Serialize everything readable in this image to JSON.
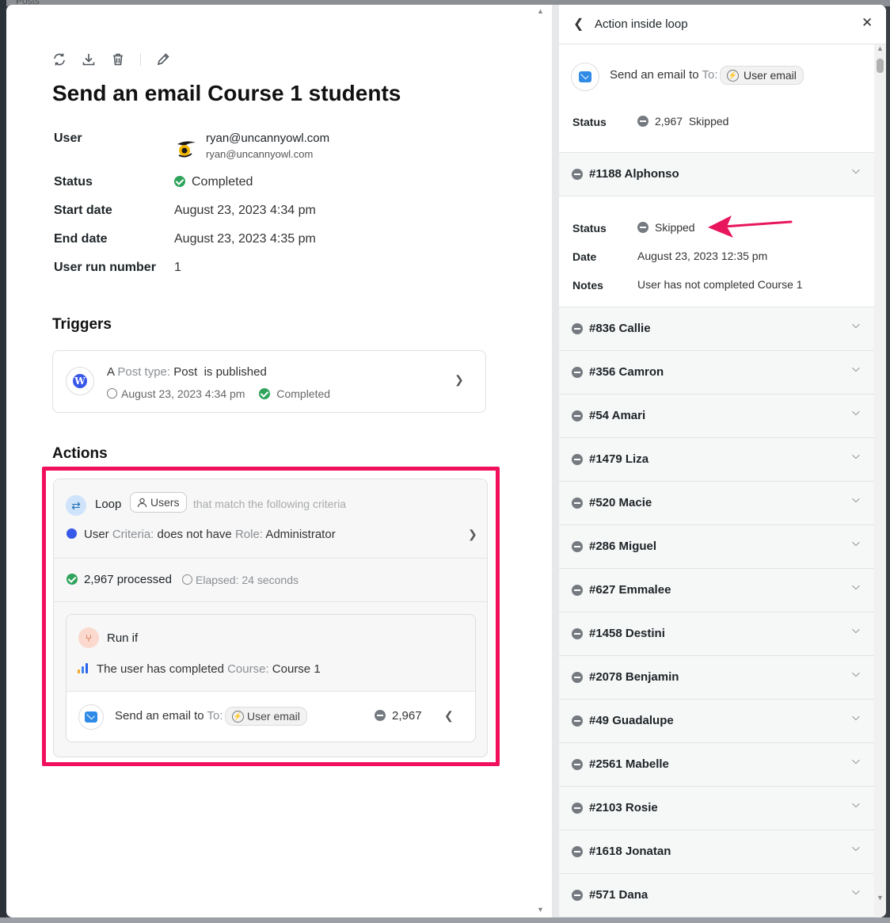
{
  "background": {
    "top_hint": "Posts"
  },
  "toolbar": {
    "icons": [
      "refresh-icon",
      "download-icon",
      "trash-icon",
      "edit-icon"
    ]
  },
  "page": {
    "title": "Send an email Course 1 students"
  },
  "meta": {
    "user_label": "User",
    "user_name": "ryan@uncannyowl.com",
    "user_email": "ryan@uncannyowl.com",
    "status_label": "Status",
    "status_value": "Completed",
    "start_label": "Start date",
    "start_value": "August 23, 2023 4:34 pm",
    "end_label": "End date",
    "end_value": "August 23, 2023 4:35 pm",
    "run_label": "User run number",
    "run_value": "1"
  },
  "triggers": {
    "heading": "Triggers",
    "a": "A",
    "post_type_label": "Post type:",
    "post_type_value": "Post",
    "published": "is published",
    "date": "August 23, 2023 4:34 pm",
    "status": "Completed"
  },
  "actions": {
    "heading": "Actions",
    "loop_label": "Loop",
    "loop_pill": "Users",
    "loop_criteria": "that match the following criteria",
    "crit_label": "User",
    "crit_key": "Criteria:",
    "crit_text": "does not have",
    "role_label": "Role:",
    "role_value": "Administrator",
    "processed": "2,967 processed",
    "elapsed": "Elapsed: 24 seconds",
    "runif_label": "Run if",
    "cond_text": "The user has completed",
    "cond_key": "Course:",
    "cond_value": "Course 1",
    "send_text": "Send an email to",
    "send_to": "To:",
    "send_pill": "User email",
    "send_count": "2,967"
  },
  "panel": {
    "title": "Action inside loop",
    "send_text": "Send an email to",
    "send_to": "To:",
    "send_pill": "User email",
    "status_label": "Status",
    "status_count": "2,967",
    "status_value": "Skipped",
    "expanded": {
      "name": "#1188 Alphonso",
      "status_label": "Status",
      "status_value": "Skipped",
      "date_label": "Date",
      "date_value": "August 23, 2023 12:35 pm",
      "notes_label": "Notes",
      "notes_value": "User has not completed Course 1"
    },
    "items": [
      "#836 Callie",
      "#356 Camron",
      "#54 Amari",
      "#1479 Liza",
      "#520 Macie",
      "#286 Miguel",
      "#627 Emmalee",
      "#1458 Destini",
      "#2078 Benjamin",
      "#49 Guadalupe",
      "#2561 Mabelle",
      "#2103 Rosie",
      "#1618 Jonatan",
      "#571 Dana"
    ]
  },
  "colors": {
    "highlight": "#f0105d",
    "success": "#2fa35b",
    "skipped": "#757a80",
    "arrow": "#e8175d"
  }
}
